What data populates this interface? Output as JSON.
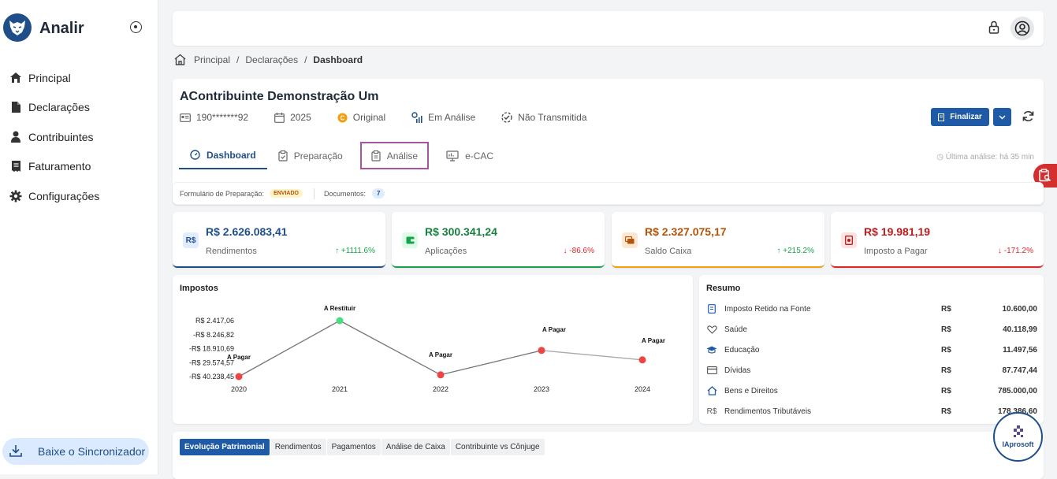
{
  "app": {
    "brand": "Analir"
  },
  "sidebar": {
    "items": [
      {
        "label": "Principal",
        "icon": "home-icon"
      },
      {
        "label": "Declarações",
        "icon": "file-icon"
      },
      {
        "label": "Contribuintes",
        "icon": "user-icon"
      },
      {
        "label": "Faturamento",
        "icon": "receipt-icon"
      },
      {
        "label": "Configurações",
        "icon": "gear-icon"
      }
    ],
    "sync_label": "Baixe o Sincronizador"
  },
  "breadcrumb": {
    "home": "Principal",
    "mid": "Declarações",
    "current": "Dashboard"
  },
  "header": {
    "name": "AContribuinte Demonstração Um",
    "cpf": "190*******92",
    "year": "2025",
    "type": "Original",
    "status": "Em Análise",
    "trans": "Não Transmitida",
    "finalize": "Finalizar",
    "last_analysis": "Última análise: há 35 min"
  },
  "tabs": [
    "Dashboard",
    "Preparação",
    "Análise",
    "e-CAC"
  ],
  "form": {
    "label": "Formulário de Preparação:",
    "status": "ENVIADO",
    "docs_label": "Documentos:",
    "docs_count": "7"
  },
  "kpis": [
    {
      "value": "R$ 2.626.083,41",
      "label": "Rendimentos",
      "change": "↑ +1111.6%",
      "color": "#1f4e89",
      "change_color": "#16a34a",
      "icon": "R$",
      "icon_bg": "#e0ecff"
    },
    {
      "value": "R$ 300.341,24",
      "label": "Aplicações",
      "change": "↓ -86.6%",
      "color": "#15803d",
      "change_color": "#dc2626",
      "icon": "wallet",
      "icon_bg": "#dcfce7"
    },
    {
      "value": "R$ 2.327.075,17",
      "label": "Saldo Caixa",
      "change": "↑ +215.2%",
      "color": "#b45309",
      "change_color": "#16a34a",
      "icon": "cash",
      "icon_bg": "#fde7d0"
    },
    {
      "value": "R$ 19.981,19",
      "label": "Imposto a Pagar",
      "change": "↓ -171.2%",
      "color": "#b91c1c",
      "change_color": "#dc2626",
      "icon": "tax",
      "icon_bg": "#fde2e2"
    }
  ],
  "impostos": {
    "title": "Impostos"
  },
  "chart_data": {
    "type": "line",
    "title": "Impostos",
    "x": [
      "2020",
      "2021",
      "2022",
      "2023",
      "2024"
    ],
    "values": [
      -40238.45,
      2417.06,
      -38900,
      -20300,
      -27500
    ],
    "point_labels": [
      "A Pagar",
      "A Restituir",
      "A Pagar",
      "A Pagar",
      "A Pagar"
    ],
    "point_colors": [
      "#ef4444",
      "#4ade80",
      "#ef4444",
      "#ef4444",
      "#ef4444"
    ],
    "y_ticks": [
      "R$ 2.417,06",
      "-R$ 8.246,82",
      "-R$ 18.910,69",
      "-R$ 29.574,57",
      "-R$ 40.238,45"
    ],
    "ylim": [
      -40238.45,
      2417.06
    ]
  },
  "resumo": {
    "title": "Resumo",
    "rows": [
      {
        "label": "Imposto Retido na Fonte",
        "cur": "R$",
        "value": "10.600,00",
        "icon": "receipt-icon"
      },
      {
        "label": "Saúde",
        "cur": "R$",
        "value": "40.118,99",
        "icon": "heart-icon"
      },
      {
        "label": "Educação",
        "cur": "R$",
        "value": "11.497,56",
        "icon": "graduation-cap-icon"
      },
      {
        "label": "Dívidas",
        "cur": "R$",
        "value": "87.747,44",
        "icon": "credit-card-icon"
      },
      {
        "label": "Bens e Direitos",
        "cur": "R$",
        "value": "785.000,00",
        "icon": "home-icon"
      },
      {
        "label": "Rendimentos Tributáveis",
        "cur": "R$",
        "value": "178.386,60",
        "icon": "currency-icon"
      }
    ]
  },
  "bottom_tabs": [
    "Evolução Patrimonial",
    "Rendimentos",
    "Pagamentos",
    "Análise de Caixa",
    "Contribuinte vs Cônjuge"
  ],
  "badge": {
    "text": "IAprosoft"
  }
}
